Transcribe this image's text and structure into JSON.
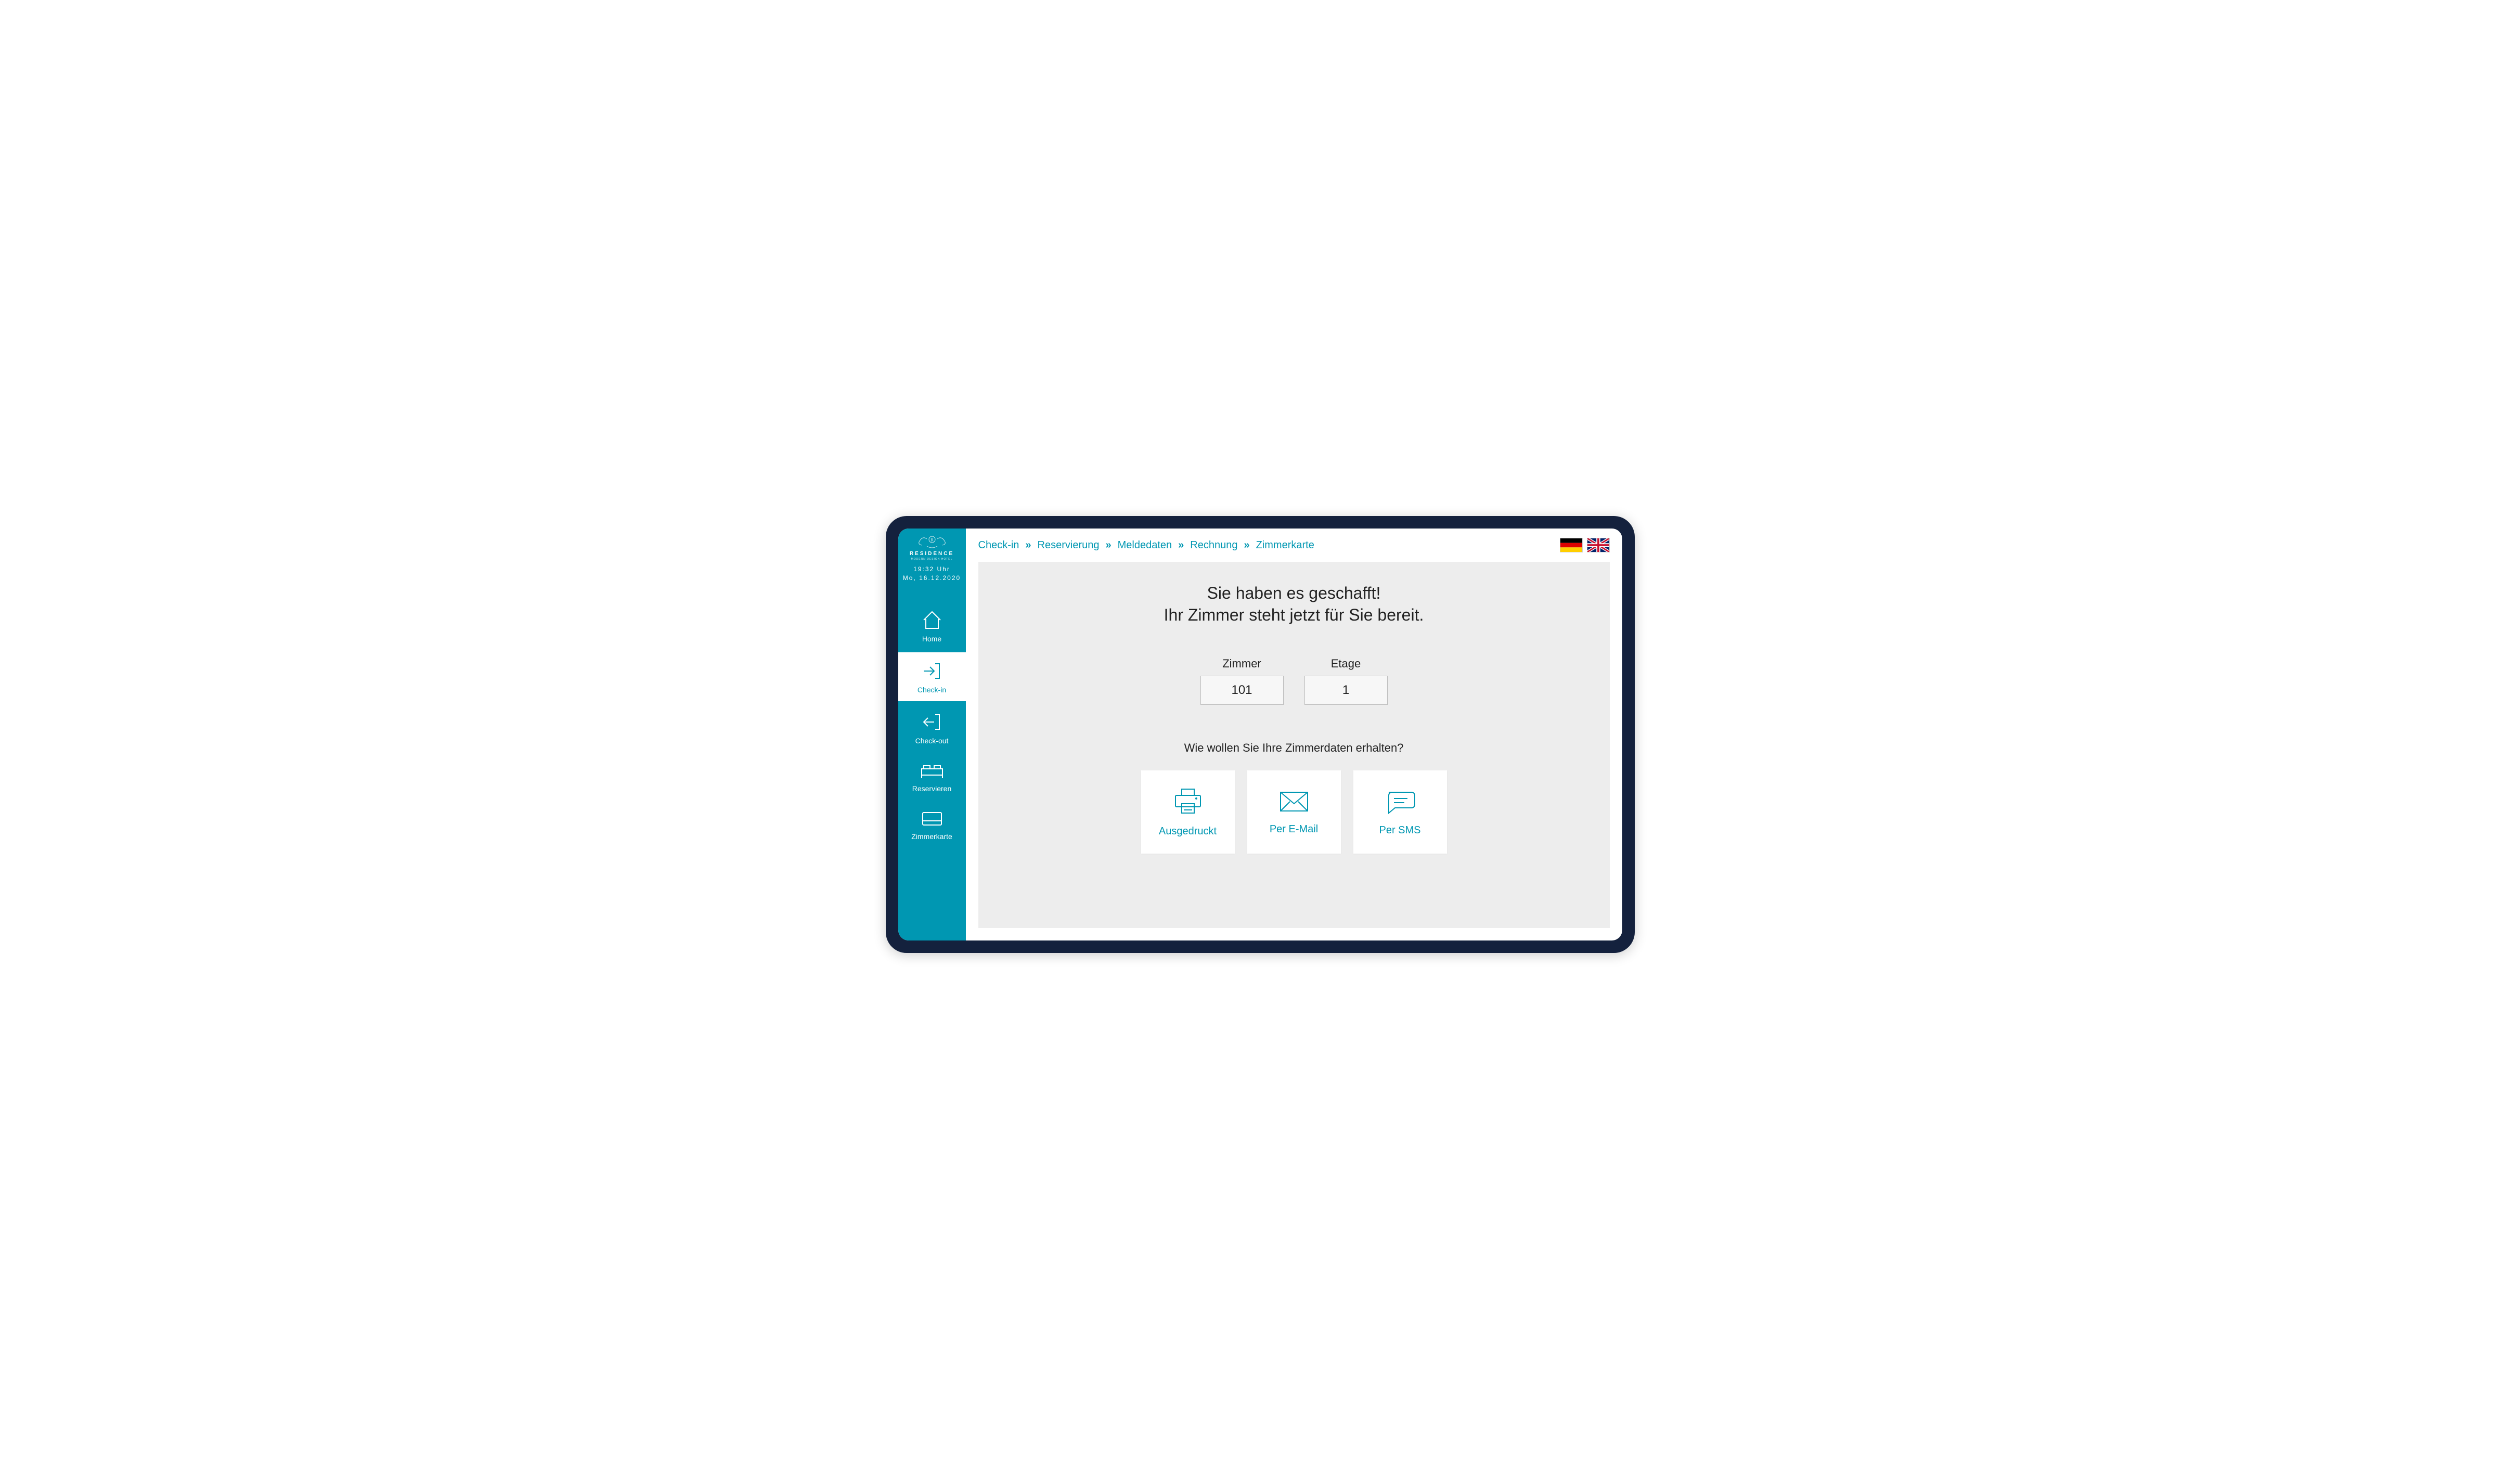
{
  "brand": {
    "name": "RESIDENCE",
    "sub": "MODERN DESIGN HOTEL"
  },
  "clock": {
    "time": "19:32 Uhr",
    "date": "Mo, 16.12.2020"
  },
  "sidebar": {
    "items": [
      {
        "label": "Home"
      },
      {
        "label": "Check-in"
      },
      {
        "label": "Check-out"
      },
      {
        "label": "Reservieren"
      },
      {
        "label": "Zimmerkarte"
      }
    ]
  },
  "breadcrumb": {
    "items": [
      "Check-in",
      "Reservierung",
      "Meldedaten",
      "Rechnung",
      "Zimmerkarte"
    ]
  },
  "main": {
    "headline1": "Sie haben es geschafft!",
    "headline2": "Ihr Zimmer steht jetzt für Sie bereit.",
    "room_label": "Zimmer",
    "room_value": "101",
    "floor_label": "Etage",
    "floor_value": "1",
    "question": "Wie wollen Sie Ihre Zimmerdaten erhalten?",
    "options": {
      "print": "Ausgedruckt",
      "email": "Per E-Mail",
      "sms": "Per SMS"
    }
  },
  "languages": {
    "de": "Deutsch",
    "en": "English"
  }
}
